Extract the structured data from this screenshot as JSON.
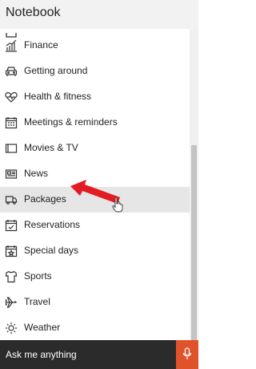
{
  "header": {
    "title": "Notebook"
  },
  "list": {
    "items": [
      {
        "label": "Finance",
        "icon": "chart-icon"
      },
      {
        "label": "Getting around",
        "icon": "car-icon"
      },
      {
        "label": "Health & fitness",
        "icon": "heart-pulse-icon"
      },
      {
        "label": "Meetings & reminders",
        "icon": "calendar-icon"
      },
      {
        "label": "Movies & TV",
        "icon": "tv-icon"
      },
      {
        "label": "News",
        "icon": "newspaper-icon"
      },
      {
        "label": "Packages",
        "icon": "truck-icon",
        "selected": true
      },
      {
        "label": "Reservations",
        "icon": "reservation-icon"
      },
      {
        "label": "Special days",
        "icon": "special-days-icon"
      },
      {
        "label": "Sports",
        "icon": "jersey-icon"
      },
      {
        "label": "Travel",
        "icon": "airplane-icon"
      },
      {
        "label": "Weather",
        "icon": "sun-icon"
      }
    ]
  },
  "search": {
    "placeholder": "Ask me anything"
  },
  "colors": {
    "accent": "#e0532a",
    "arrow": "#e31b23",
    "selected": "#e6e6e6",
    "searchbar": "#2b2b2b"
  }
}
